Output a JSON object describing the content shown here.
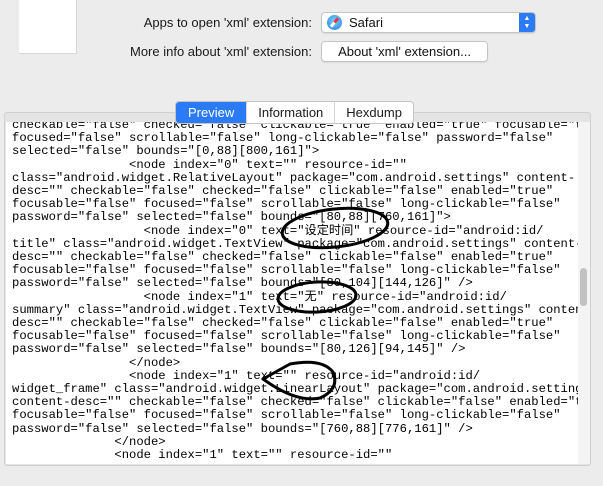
{
  "header": {
    "apps_label": "Apps to open 'xml' extension:",
    "app_selected": "Safari",
    "app_icon": "safari-icon",
    "more_info_label": "More info about 'xml' extension:",
    "about_button": "About 'xml' extension..."
  },
  "tabs": [
    {
      "label": "Preview",
      "active": true
    },
    {
      "label": "Information",
      "active": false
    },
    {
      "label": "Hexdump",
      "active": false
    }
  ],
  "accent_color": "#2c7bf6",
  "annotation_color": "#000000",
  "code_lines": [
    "checkable=\"false\" checked=\"false\" clickable=\"true\" enabled=\"true\" focusable=\"true\"",
    "focused=\"false\" scrollable=\"false\" long-clickable=\"false\" password=\"false\"",
    "selected=\"false\" bounds=\"[0,88][800,161]\">",
    "                <node index=\"0\" text=\"\" resource-id=\"\"",
    "class=\"android.widget.RelativeLayout\" package=\"com.android.settings\" content-",
    "desc=\"\" checkable=\"false\" checked=\"false\" clickable=\"false\" enabled=\"true\"",
    "focusable=\"false\" focused=\"false\" scrollable=\"false\" long-clickable=\"false\"",
    "password=\"false\" selected=\"false\" bounds=\"[80,88][760,161]\">",
    "                  <node index=\"0\" text=\"设定时间\" resource-id=\"android:id/",
    "title\" class=\"android.widget.TextView\" package=\"com.android.settings\" content-",
    "desc=\"\" checkable=\"false\" checked=\"false\" clickable=\"false\" enabled=\"true\"",
    "focusable=\"false\" focused=\"false\" scrollable=\"false\" long-clickable=\"false\"",
    "password=\"false\" selected=\"false\" bounds=\"[80,104][144,126]\" />",
    "                  <node index=\"1\" text=\"无\" resource-id=\"android:id/",
    "summary\" class=\"android.widget.TextView\" package=\"com.android.settings\" content-",
    "desc=\"\" checkable=\"false\" checked=\"false\" clickable=\"false\" enabled=\"true\"",
    "focusable=\"false\" focused=\"false\" scrollable=\"false\" long-clickable=\"false\"",
    "password=\"false\" selected=\"false\" bounds=\"[80,126][94,145]\" />",
    "                </node>",
    "                <node index=\"1\" text=\"\" resource-id=\"android:id/",
    "widget_frame\" class=\"android.widget.LinearLayout\" package=\"com.android.settings\"",
    "content-desc=\"\" checkable=\"false\" checked=\"false\" clickable=\"false\" enabled=\"true\"",
    "focusable=\"false\" focused=\"false\" scrollable=\"false\" long-clickable=\"false\"",
    "password=\"false\" selected=\"false\" bounds=\"[760,88][776,161]\" />",
    "              </node>",
    "              <node index=\"1\" text=\"\" resource-id=\"\""
  ]
}
